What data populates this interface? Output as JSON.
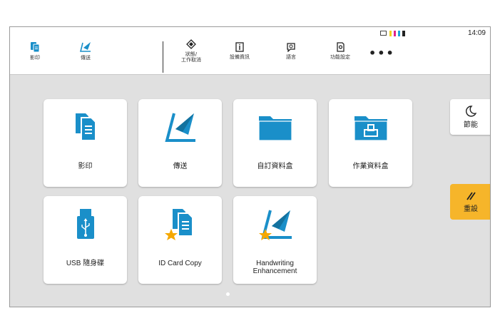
{
  "topbar": {
    "copy_label": "影印",
    "send_label": "傳送",
    "status_label": "狀態/\n工作取消",
    "device_info_label": "設備資訊",
    "language_label": "語言",
    "function_settings_label": "功能設定",
    "more_label": "•••",
    "clock": "14:09",
    "toner_colors": [
      "#f2d21b",
      "#e0218a",
      "#1fa3dc",
      "#222222"
    ]
  },
  "tiles": [
    {
      "label": "影印",
      "icon": "copy-icon"
    },
    {
      "label": "傳送",
      "icon": "send-icon"
    },
    {
      "label": "自訂資料盒",
      "icon": "custom-box-icon"
    },
    {
      "label": "作業資料盒",
      "icon": "job-box-icon"
    },
    {
      "label": "USB 隨身碟",
      "icon": "usb-icon"
    },
    {
      "label": "ID Card Copy",
      "icon": "id-card-copy-icon"
    },
    {
      "label_line1": "Handwriting",
      "label_line2": "Enhancement",
      "icon": "handwriting-enhancement-icon"
    }
  ],
  "side": {
    "energy_saver_label": "節能",
    "reset_label": "重設"
  },
  "colors": {
    "accent_blue": "#1a8fc9",
    "star": "#f5a800",
    "reset_bg": "#f6b52a"
  }
}
